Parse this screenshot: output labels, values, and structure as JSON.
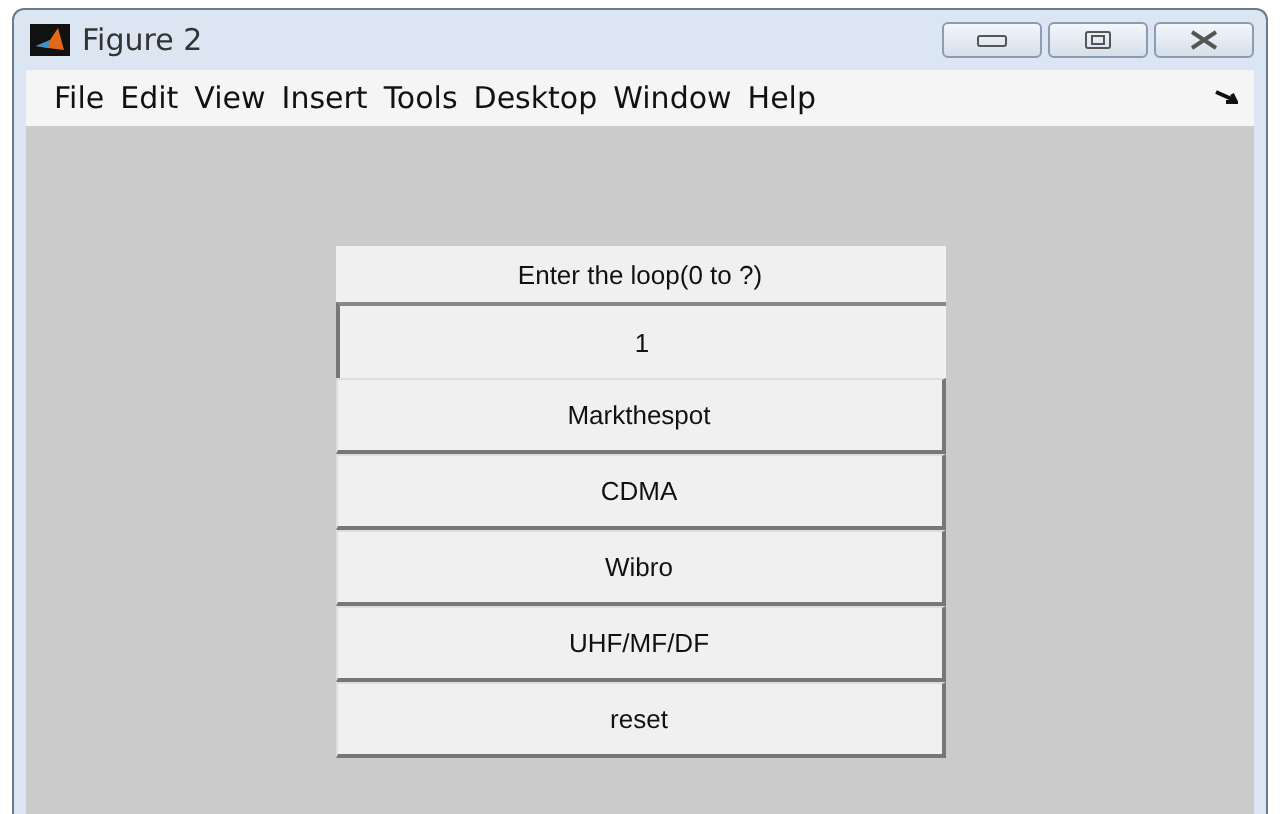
{
  "window": {
    "title": "Figure 2"
  },
  "menu": [
    "File",
    "Edit",
    "View",
    "Insert",
    "Tools",
    "Desktop",
    "Window",
    "Help"
  ],
  "label": "Enter the loop(0 to ?)",
  "input": {
    "value": "1"
  },
  "buttons": [
    "Markthespot",
    "CDMA",
    "Wibro",
    "UHF/MF/DF",
    "reset"
  ]
}
